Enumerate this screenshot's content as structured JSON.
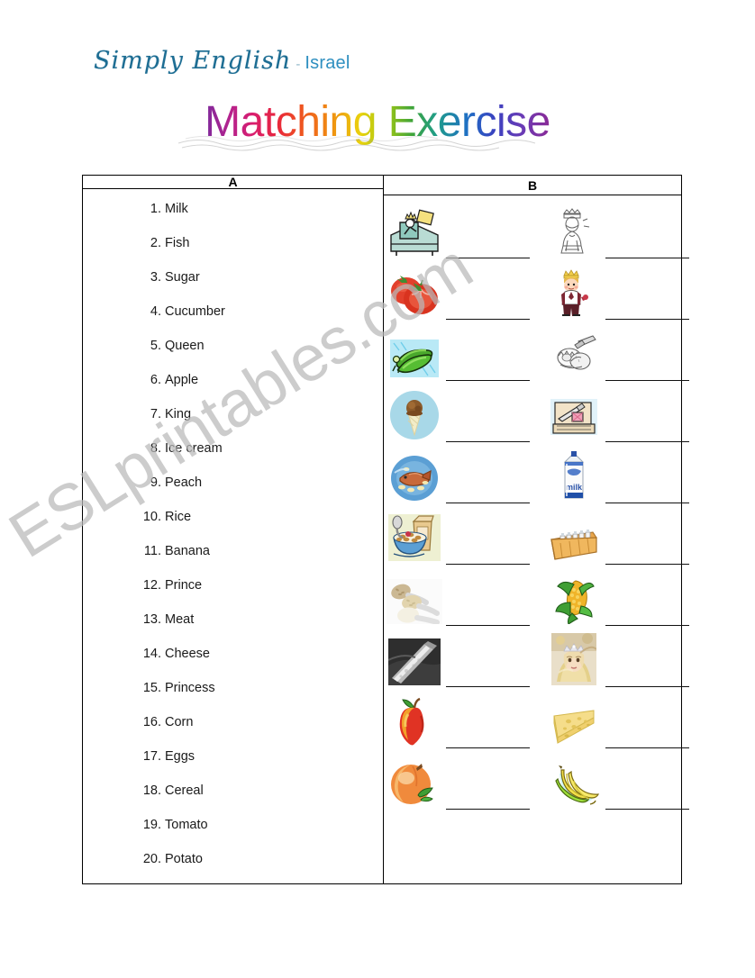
{
  "logo": {
    "brand": "Simply English",
    "separator": "-",
    "country": "Israel"
  },
  "title": "Matching Exercise",
  "watermark": "ESLprintables.com",
  "table": {
    "column_a_header": "A",
    "column_b_header": "B"
  },
  "column_a": {
    "items": [
      {
        "num": "1.",
        "word": "Milk"
      },
      {
        "num": "2.",
        "word": "Fish"
      },
      {
        "num": "3.",
        "word": "Sugar"
      },
      {
        "num": "4.",
        "word": "Cucumber"
      },
      {
        "num": "5.",
        "word": "Queen"
      },
      {
        "num": "6.",
        "word": "Apple"
      },
      {
        "num": "7.",
        "word": "King"
      },
      {
        "num": "8.",
        "word": "Ice cream"
      },
      {
        "num": "9.",
        "word": "Peach"
      },
      {
        "num": "10.",
        "word": "Rice"
      },
      {
        "num": "11.",
        "word": "Banana"
      },
      {
        "num": "12.",
        "word": "Prince"
      },
      {
        "num": "13.",
        "word": "Meat"
      },
      {
        "num": "14.",
        "word": "Cheese"
      },
      {
        "num": "15.",
        "word": "Princess"
      },
      {
        "num": "16.",
        "word": "Corn"
      },
      {
        "num": "17.",
        "word": "Eggs"
      },
      {
        "num": "18.",
        "word": "Cereal"
      },
      {
        "num": "19.",
        "word": "Tomato"
      },
      {
        "num": "20.",
        "word": "Potato"
      }
    ]
  },
  "column_b": {
    "answer_line_placeholder": "",
    "rows": [
      {
        "left": {
          "icon": "king-on-throne-icon"
        },
        "right": {
          "icon": "queen-sketch-icon"
        }
      },
      {
        "left": {
          "icon": "tomato-icon"
        },
        "right": {
          "icon": "prince-icon"
        }
      },
      {
        "left": {
          "icon": "cucumber-icon"
        },
        "right": {
          "icon": "cracked-eggs-icon"
        }
      },
      {
        "left": {
          "icon": "ice-cream-cone-icon"
        },
        "right": {
          "icon": "sugar-packet-icon"
        }
      },
      {
        "left": {
          "icon": "fish-dish-icon"
        },
        "right": {
          "icon": "milk-carton-icon"
        }
      },
      {
        "left": {
          "icon": "cereal-bowl-icon"
        },
        "right": {
          "icon": "milk-bottle-crate-icon"
        }
      },
      {
        "left": {
          "icon": "rice-spoons-icon"
        },
        "right": {
          "icon": "corn-cob-icon"
        }
      },
      {
        "left": {
          "icon": "meat-grill-icon"
        },
        "right": {
          "icon": "princess-girl-icon"
        }
      },
      {
        "left": {
          "icon": "apple-icon"
        },
        "right": {
          "icon": "cheese-wedge-icon"
        }
      },
      {
        "left": {
          "icon": "peach-icon"
        },
        "right": {
          "icon": "banana-bunch-icon"
        }
      }
    ]
  }
}
